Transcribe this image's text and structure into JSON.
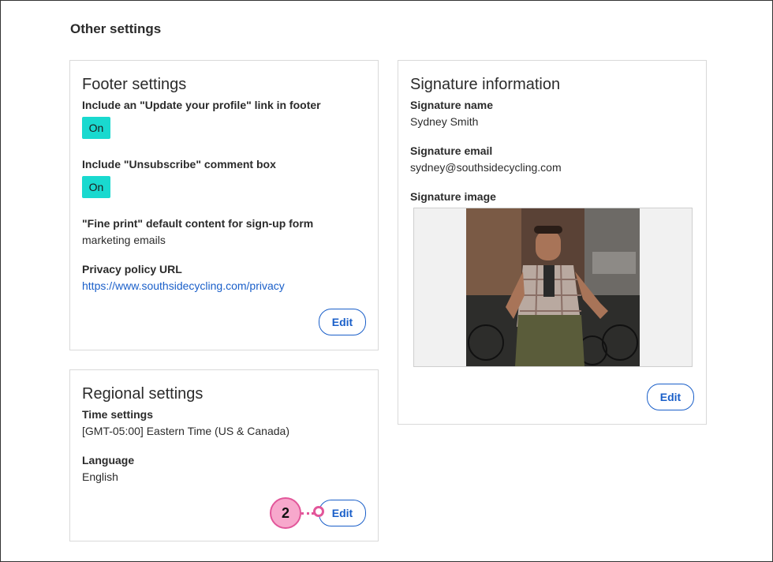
{
  "page": {
    "title": "Other settings"
  },
  "footer": {
    "title": "Footer settings",
    "update_profile_label": "Include an \"Update your profile\" link in footer",
    "update_profile_toggle": "On",
    "unsubscribe_label": "Include \"Unsubscribe\" comment box",
    "unsubscribe_toggle": "On",
    "fine_print_label": "\"Fine print\" default content for sign-up form",
    "fine_print_value": "marketing emails",
    "privacy_label": "Privacy policy URL",
    "privacy_url": "https://www.southsidecycling.com/privacy",
    "edit_label": "Edit"
  },
  "regional": {
    "title": "Regional settings",
    "time_label": "Time settings",
    "time_value": "[GMT-05:00] Eastern Time (US & Canada)",
    "language_label": "Language",
    "language_value": "English",
    "edit_label": "Edit"
  },
  "signature": {
    "title": "Signature information",
    "name_label": "Signature name",
    "name_value": "Sydney Smith",
    "email_label": "Signature email",
    "email_value": "sydney@southsidecycling.com",
    "image_label": "Signature image",
    "edit_label": "Edit"
  },
  "callout": {
    "number": "2"
  },
  "colors": {
    "toggle_on": "#19d9cf",
    "link": "#1a5fc9",
    "callout_fill": "#f7a8cc",
    "callout_border": "#e2569a"
  }
}
